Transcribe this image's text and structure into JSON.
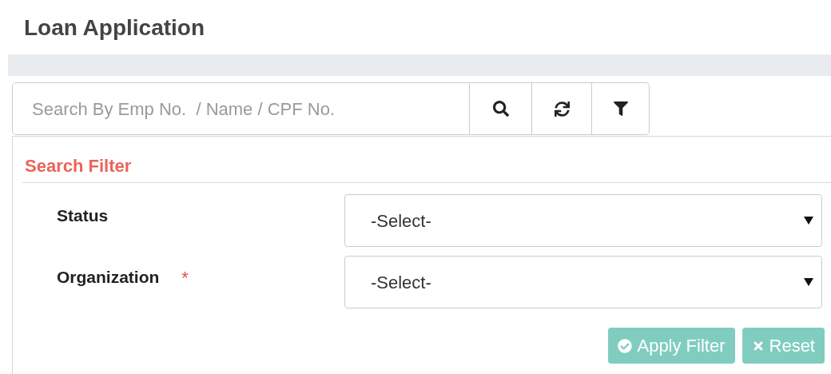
{
  "page_title": "Loan Application",
  "search": {
    "placeholder": "Search By Emp No.  / Name / CPF No."
  },
  "filter": {
    "title": "Search Filter",
    "fields": [
      {
        "label": "Status",
        "value": "-Select-"
      },
      {
        "label": "Organization",
        "required_mark": "*",
        "value": "-Select-"
      }
    ],
    "buttons": [
      {
        "kind": "apply",
        "label": "Apply Filter"
      },
      {
        "kind": "reset",
        "label": "Reset"
      }
    ]
  }
}
